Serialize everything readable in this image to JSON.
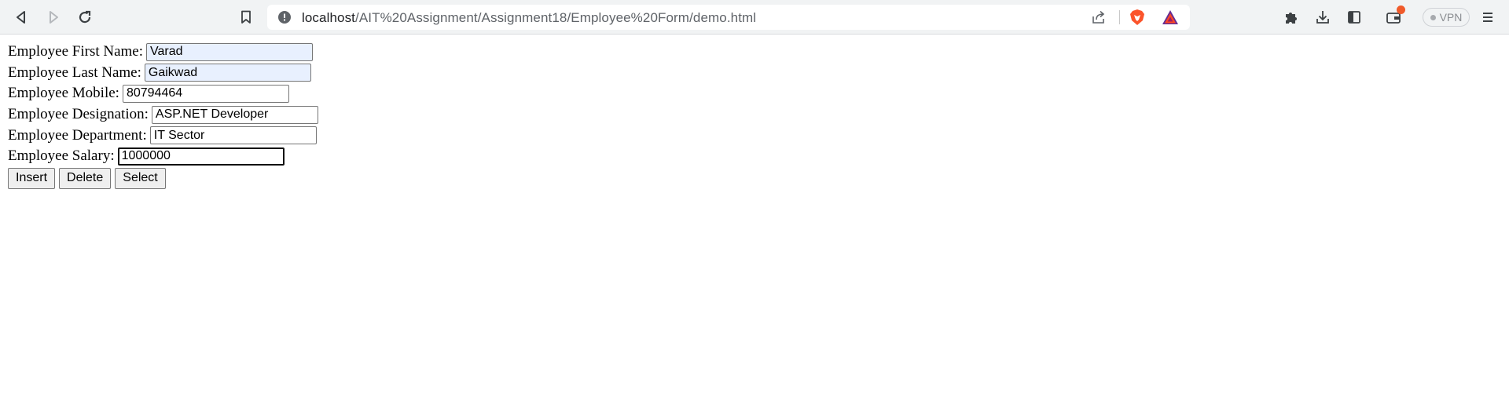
{
  "browser": {
    "url_host": "localhost",
    "url_path": "/AIT%20Assignment/Assignment18/Employee%20Form/demo.html",
    "vpn_label": "VPN",
    "accent_brave": "#fb542b",
    "wallet_badge_color": "#f05a2a"
  },
  "form": {
    "fields": [
      {
        "label": "Employee First Name:",
        "value": "Varad"
      },
      {
        "label": "Employee Last Name:",
        "value": "Gaikwad"
      },
      {
        "label": "Employee Mobile:",
        "value": "80794464"
      },
      {
        "label": "Employee Designation:",
        "value": "ASP.NET Developer"
      },
      {
        "label": "Employee Department:",
        "value": "IT Sector"
      },
      {
        "label": "Employee Salary:",
        "value": "1000000"
      }
    ],
    "buttons": {
      "insert": "Insert",
      "delete": "Delete",
      "select": "Select"
    }
  }
}
